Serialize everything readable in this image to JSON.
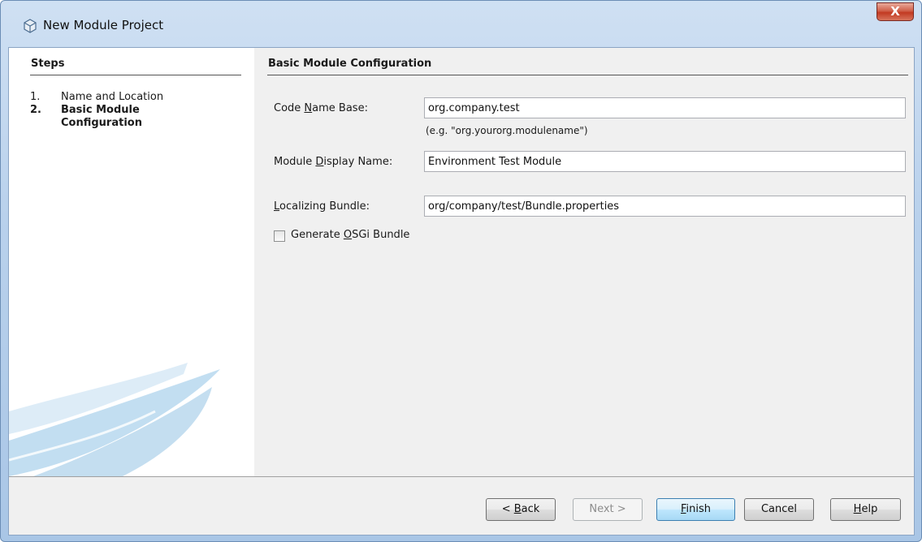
{
  "window": {
    "title": "New Module Project",
    "close_glyph": "X",
    "icon": "cube-icon"
  },
  "steps": {
    "heading": "Steps",
    "items": [
      {
        "number": "1.",
        "label": "Name and Location",
        "active": false
      },
      {
        "number": "2.",
        "label": "Basic Module Configuration",
        "active": true
      }
    ]
  },
  "form": {
    "heading": "Basic Module Configuration",
    "code_name_base": {
      "label_pre": "Code ",
      "label_mnemonic": "N",
      "label_post": "ame Base:",
      "value": "org.company.test",
      "hint": "(e.g. \"org.yourorg.modulename\")"
    },
    "display_name": {
      "label_pre": "Module ",
      "label_mnemonic": "D",
      "label_post": "isplay Name:",
      "value": "Environment Test Module"
    },
    "localizing_bundle": {
      "label_pre": "",
      "label_mnemonic": "L",
      "label_post": "ocalizing Bundle:",
      "value": "org/company/test/Bundle.properties"
    },
    "osgi": {
      "label_pre": "Generate ",
      "label_mnemonic": "O",
      "label_post": "SGi Bundle",
      "checked": false
    }
  },
  "buttons": {
    "back": {
      "pre": "< ",
      "mnemonic": "B",
      "post": "ack"
    },
    "next": {
      "label": "Next >",
      "enabled": false
    },
    "finish": {
      "pre": "",
      "mnemonic": "F",
      "post": "inish"
    },
    "cancel": {
      "label": "Cancel"
    },
    "help": {
      "pre": "",
      "mnemonic": "H",
      "post": "elp"
    }
  },
  "colors": {
    "frame": "#b9d1ec",
    "panel": "#f0f0f0",
    "swoosh": "#9cc8e6",
    "close": "#c23a22"
  }
}
